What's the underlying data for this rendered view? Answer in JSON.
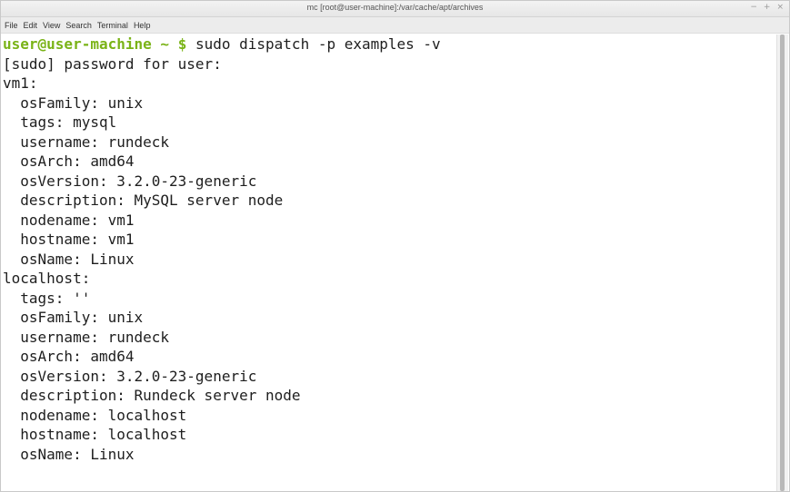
{
  "window": {
    "title": "mc [root@user-machine]:/var/cache/apt/archives",
    "controls": [
      "−",
      "+",
      "×"
    ]
  },
  "menubar": {
    "items": [
      "File",
      "Edit",
      "View",
      "Search",
      "Terminal",
      "Help"
    ]
  },
  "terminal": {
    "prompt": {
      "user_host": "user@user-machine",
      "path": "~",
      "symbol": "$",
      "command": "sudo dispatch -p examples -v"
    },
    "lines": [
      "[sudo] password for user:",
      "vm1:",
      "  osFamily: unix",
      "  tags: mysql",
      "  username: rundeck",
      "  osArch: amd64",
      "  osVersion: 3.2.0-23-generic",
      "  description: MySQL server node",
      "  nodename: vm1",
      "  hostname: vm1",
      "  osName: Linux",
      "localhost:",
      "  tags: ''",
      "  osFamily: unix",
      "  username: rundeck",
      "  osArch: amd64",
      "  osVersion: 3.2.0-23-generic",
      "  description: Rundeck server node",
      "  nodename: localhost",
      "  hostname: localhost",
      "  osName: Linux"
    ]
  },
  "colors": {
    "prompt": "#7ab317",
    "text": "#1e1e1e",
    "background": "#ffffff"
  }
}
